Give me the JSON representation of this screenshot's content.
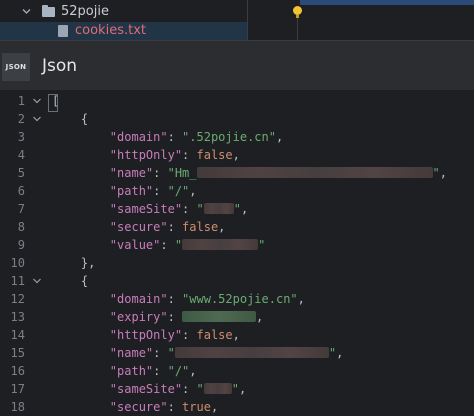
{
  "tree": {
    "folder_label": "52pojie",
    "file_label": "cookies.txt"
  },
  "header": {
    "badge": "JSON",
    "title": "Json"
  },
  "colors": {
    "key": "#c77dbb",
    "string": "#6aab73",
    "keyword": "#cf8e6d",
    "punct": "#bcbec4",
    "line_number": "#7b7f86",
    "file_label": "#e06c75"
  },
  "icons": [
    "chevron-down-icon",
    "folder-icon",
    "file-icon",
    "lightbulb-icon",
    "json-icon",
    "fold-chevron-icon"
  ],
  "code": {
    "line_numbers": [
      "1",
      "2",
      "3",
      "4",
      "5",
      "6",
      "7",
      "8",
      "9",
      "10",
      "11",
      "12",
      "13",
      "14",
      "15",
      "16",
      "17",
      "18"
    ],
    "l1": "[",
    "l2": "{",
    "l3_key": "\"domain\"",
    "l3_val": "\".52pojie.cn\"",
    "l4_key": "\"httpOnly\"",
    "l4_val": "false",
    "l5_key": "\"name\"",
    "l5_val": "\"Hm_",
    "l6_key": "\"path\"",
    "l6_val": "\"/\"",
    "l7_key": "\"sameSite\"",
    "l8_key": "\"secure\"",
    "l8_val": "false",
    "l9_key": "\"value\"",
    "l10": "},",
    "l11": "{",
    "l12_key": "\"domain\"",
    "l12_val": "\"www.52pojie.cn\"",
    "l13_key": "\"expiry\"",
    "l14_key": "\"httpOnly\"",
    "l14_val": "false",
    "l15_key": "\"name\"",
    "l16_key": "\"path\"",
    "l16_val": "\"/\"",
    "l17_key": "\"sameSite\"",
    "l18_key": "\"secure\"",
    "l18_val": "true"
  }
}
